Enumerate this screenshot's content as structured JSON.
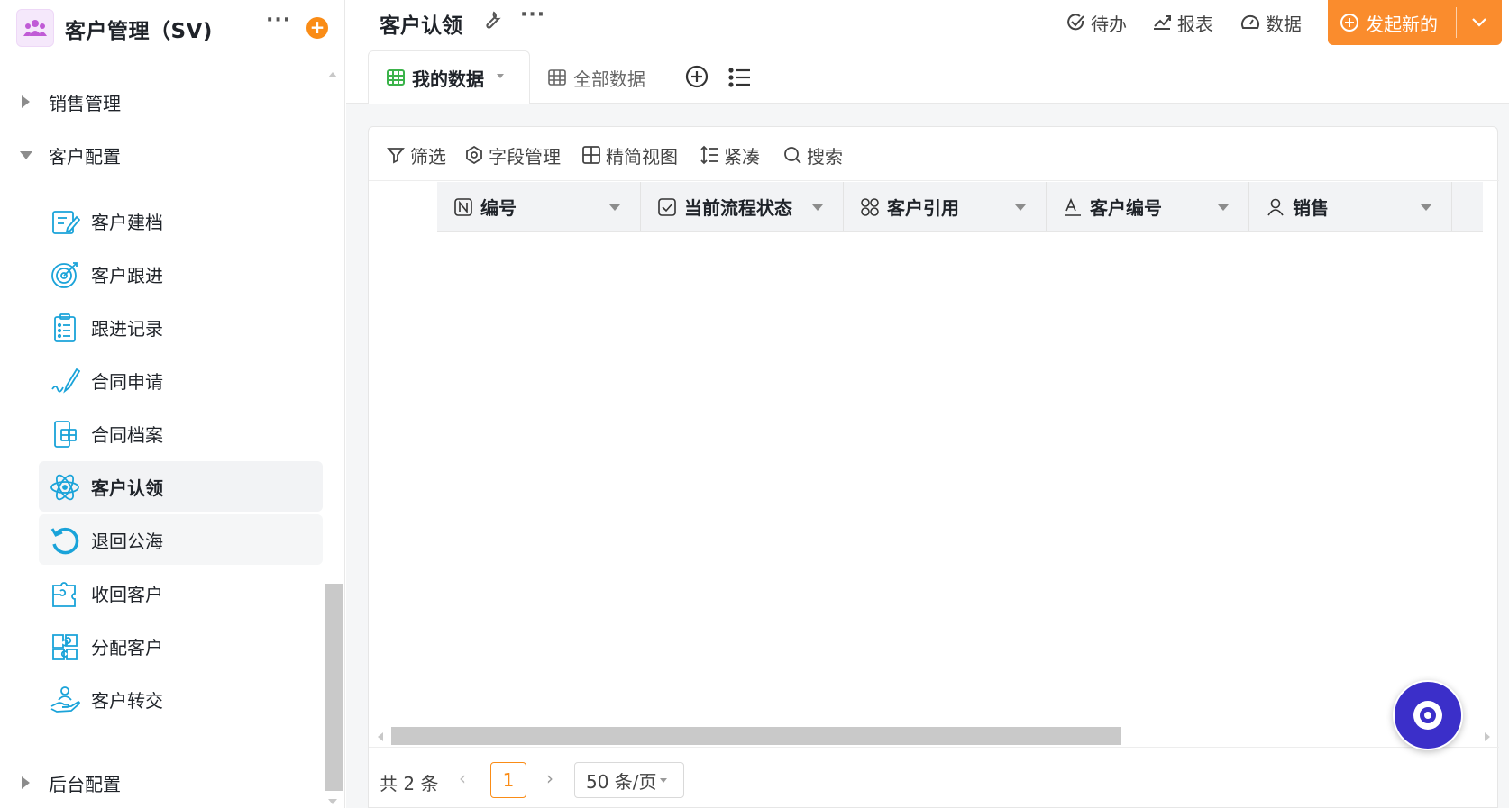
{
  "app": {
    "title": "客户管理（SV)",
    "logo_icon": "users-icon",
    "accent_color": "#fa8c16"
  },
  "sidebar": {
    "groups": [
      {
        "label": "销售管理",
        "expanded": false
      },
      {
        "label": "客户配置",
        "expanded": true
      },
      {
        "label": "后台配置",
        "expanded": false
      }
    ],
    "items": [
      {
        "label": "客户建档",
        "icon": "form-edit-icon"
      },
      {
        "label": "客户跟进",
        "icon": "target-icon"
      },
      {
        "label": "跟进记录",
        "icon": "clipboard-list-icon"
      },
      {
        "label": "合同申请",
        "icon": "pen-signature-icon"
      },
      {
        "label": "合同档案",
        "icon": "contract-archive-icon"
      },
      {
        "label": "客户认领",
        "icon": "atom-icon",
        "active": true
      },
      {
        "label": "退回公海",
        "icon": "undo-circle-icon"
      },
      {
        "label": "收回客户",
        "icon": "puzzle-icon"
      },
      {
        "label": "分配客户",
        "icon": "puzzle-pieces-icon"
      },
      {
        "label": "客户转交",
        "icon": "hand-user-icon"
      }
    ]
  },
  "header": {
    "page_title": "客户认领",
    "actions": [
      {
        "label": "待办",
        "icon": "check-circle-icon"
      },
      {
        "label": "报表",
        "icon": "trend-chart-icon"
      },
      {
        "label": "数据",
        "icon": "dashboard-icon"
      }
    ],
    "launch_button": "发起新的"
  },
  "tabs": [
    {
      "label": "我的数据",
      "active": true,
      "icon": "table-icon"
    },
    {
      "label": "全部数据",
      "active": false,
      "icon": "table-icon"
    }
  ],
  "toolbar": {
    "filter": "筛选",
    "fields": "字段管理",
    "compact_view": "精简视图",
    "density": "紧凑",
    "search": "搜索"
  },
  "table": {
    "columns": [
      {
        "label": "编号",
        "icon": "number-field-icon"
      },
      {
        "label": "当前流程状态",
        "icon": "checkbox-icon"
      },
      {
        "label": "客户引用",
        "icon": "relation-icon"
      },
      {
        "label": "客户编号",
        "icon": "text-field-icon"
      },
      {
        "label": "销售",
        "icon": "person-icon"
      }
    ],
    "rows": []
  },
  "pagination": {
    "total": "共 2 条",
    "current_page": "1",
    "page_size": "50 条/页"
  }
}
